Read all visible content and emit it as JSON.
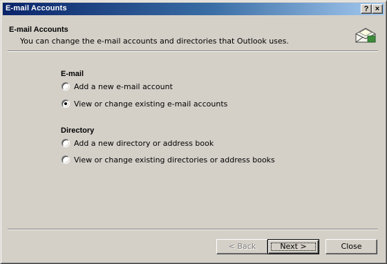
{
  "window": {
    "title": "E-mail Accounts"
  },
  "titlebar_buttons": {
    "help": "?",
    "close": "×"
  },
  "header": {
    "title": "E-mail Accounts",
    "subtitle": "You can change the e-mail accounts and directories that Outlook uses.",
    "icon": "envelope-icon"
  },
  "email_group": {
    "title": "E-mail",
    "options": [
      {
        "label": "Add a new e-mail account",
        "selected": false
      },
      {
        "label": "View or change existing e-mail accounts",
        "selected": true
      }
    ]
  },
  "directory_group": {
    "title": "Directory",
    "options": [
      {
        "label": "Add a new directory or address book",
        "selected": false
      },
      {
        "label": "View or change existing directories or address books",
        "selected": false
      }
    ]
  },
  "buttons": {
    "back": "< Back",
    "next": "Next >",
    "close": "Close"
  },
  "colors": {
    "titlebar_start": "#0a246a",
    "titlebar_end": "#a6caf0",
    "face": "#d4d0c8"
  }
}
